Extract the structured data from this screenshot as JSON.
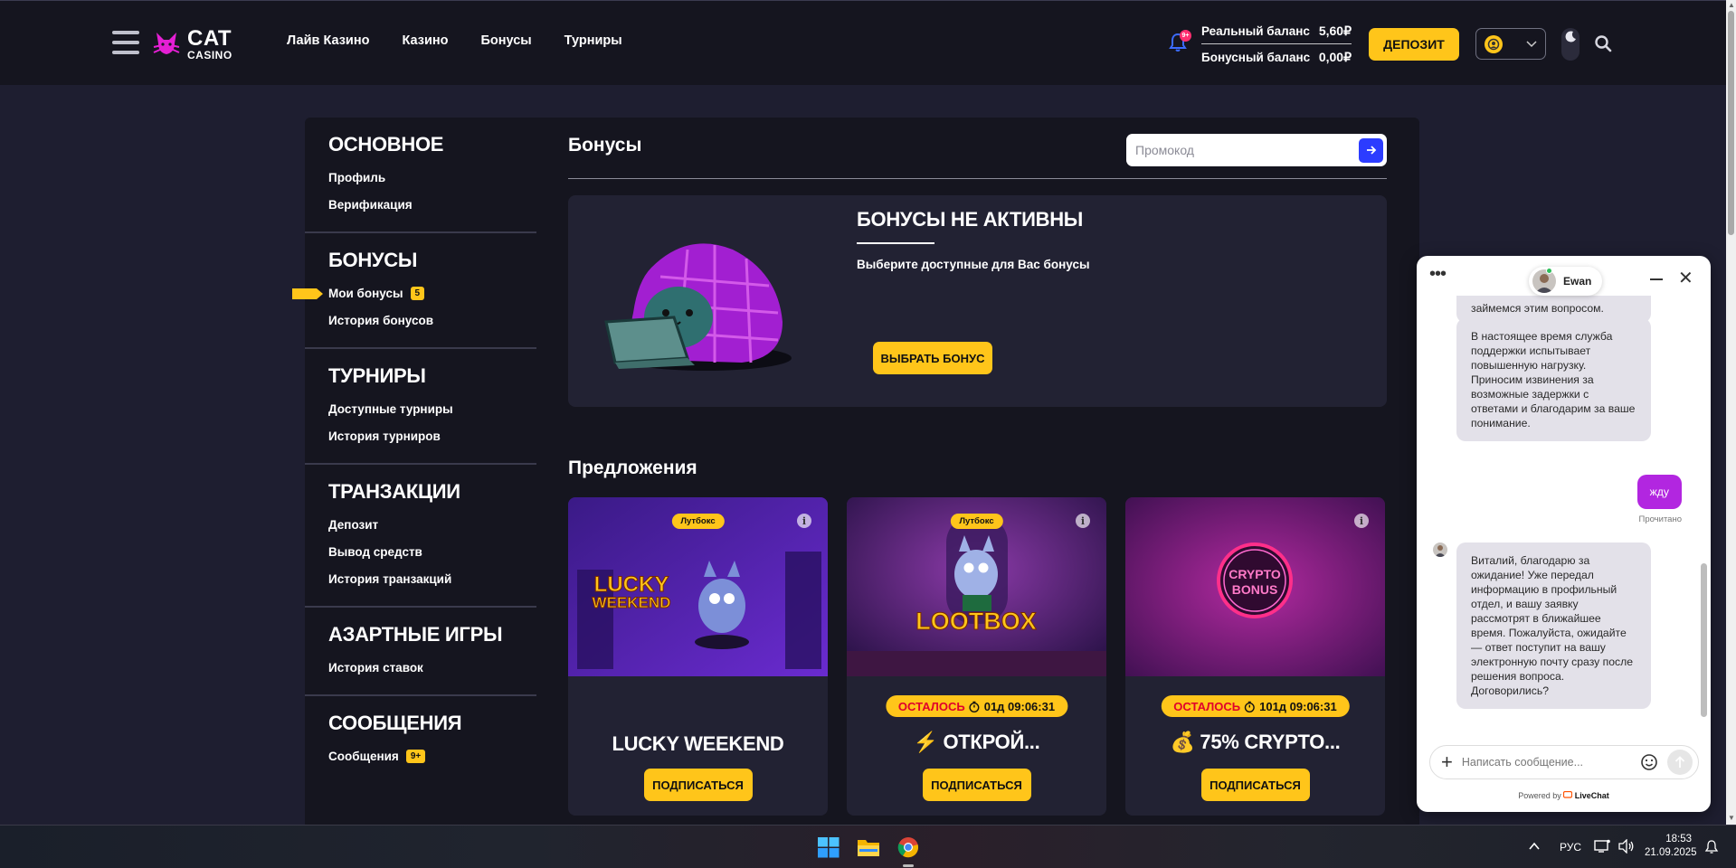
{
  "header": {
    "logo": {
      "cat": "CAT",
      "casino": "CASINO"
    },
    "nav": [
      "Лайв Казино",
      "Казино",
      "Бонусы",
      "Турниры"
    ],
    "notification_badge": "9+",
    "real_balance_label": "Реальный баланс",
    "real_balance_value": "5,60₽",
    "bonus_balance_label": "Бонусный баланс",
    "bonus_balance_value": "0,00₽",
    "deposit_label": "ДЕПОЗИТ"
  },
  "sidebar": {
    "sections": [
      {
        "title": "ОСНОВНОЕ",
        "items": [
          {
            "label": "Профиль"
          },
          {
            "label": "Верификация"
          }
        ]
      },
      {
        "title": "БОНУСЫ",
        "items": [
          {
            "label": "Мои бонусы",
            "badge": "5",
            "active": true
          },
          {
            "label": "История бонусов"
          }
        ]
      },
      {
        "title": "ТУРНИРЫ",
        "items": [
          {
            "label": "Доступные турниры"
          },
          {
            "label": "История турниров"
          }
        ]
      },
      {
        "title": "ТРАНЗАКЦИИ",
        "items": [
          {
            "label": "Депозит"
          },
          {
            "label": "Вывод средств"
          },
          {
            "label": "История транзакций"
          }
        ]
      },
      {
        "title": "АЗАРТНЫЕ ИГРЫ",
        "items": [
          {
            "label": "История ставок"
          }
        ]
      },
      {
        "title": "СООБЩЕНИЯ",
        "items": [
          {
            "label": "Сообщения",
            "badge": "9+"
          }
        ]
      }
    ]
  },
  "main": {
    "title": "Бонусы",
    "promo_placeholder": "Промокод",
    "bonus_status": {
      "title": "БОНУСЫ НЕ АКТИВНЫ",
      "subtitle": "Выберите доступные для Вас бонусы",
      "button": "ВЫБРАТЬ БОНУС"
    },
    "offers_title": "Предложения",
    "offers": [
      {
        "tag": "Лутбокс",
        "art_text": [
          "LUCKY",
          "WEEKEND"
        ],
        "timer": null,
        "name": "LUCKY WEEKEND",
        "icon": "",
        "button": "ПОДПИСАТЬСЯ"
      },
      {
        "tag": "Лутбокс",
        "art_text": [
          "LOOTBOX"
        ],
        "timer": {
          "label": "ОСТАЛОСЬ",
          "time": "01д 09:06:31"
        },
        "name": "ОТКРОЙ...",
        "icon": "⚡",
        "button": "ПОДПИСАТЬСЯ"
      },
      {
        "tag": null,
        "art_text": [
          "CRYPTO",
          "BONUS"
        ],
        "timer": {
          "label": "ОСТАЛОСЬ",
          "time": "101д 09:06:31"
        },
        "name": "75% CRYPTO...",
        "icon": "💰",
        "button": "ПОДПИСАТЬСЯ"
      }
    ]
  },
  "chat": {
    "agent_name": "Ewan",
    "partial_message": "займемся этим вопросом.",
    "messages": [
      {
        "from": "agent",
        "text": "В настоящее время служба поддержки испытывает повышенную нагрузку. Приносим извинения за возможные задержки с ответами и благодарим за ваше понимание."
      },
      {
        "from": "user",
        "text": "жду",
        "status": "Прочитано"
      },
      {
        "from": "agent",
        "text": "Виталий, благодарю за ожидание! Уже передал информацию в профильный отдел, и вашу заявку рассмотрят в ближайшее время. Пожалуйста, ожидайте — ответ поступит на вашу электронную почту сразу после решения вопроса. Договорились?"
      }
    ],
    "input_placeholder": "Написать сообщение...",
    "powered_by": "Powered by",
    "brand": "LiveChat"
  },
  "taskbar": {
    "lang": "РУС",
    "time": "18:53",
    "date": "21.09.2025"
  },
  "colors": {
    "accent": "#ffc51a",
    "background": "#1e1e30",
    "panel": "#15151f",
    "card": "#222233",
    "chat_user_bubble": "#b226e0"
  }
}
